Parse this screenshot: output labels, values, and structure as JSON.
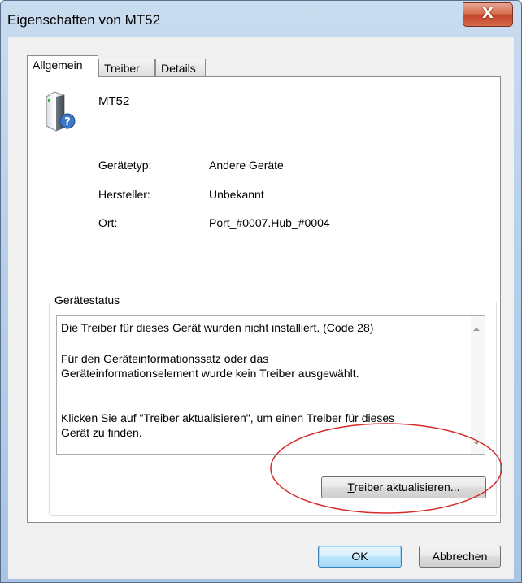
{
  "window": {
    "title": "Eigenschaften von MT52",
    "close_symbol": "X"
  },
  "tabs": [
    {
      "label": "Allgemein",
      "active": true
    },
    {
      "label": "Treiber",
      "active": false
    },
    {
      "label": "Details",
      "active": false
    }
  ],
  "device": {
    "name": "MT52",
    "icon": "unknown-device-icon"
  },
  "properties": [
    {
      "label": "Gerätetyp:",
      "value": "Andere Geräte"
    },
    {
      "label": "Hersteller:",
      "value": "Unbekannt"
    },
    {
      "label": "Ort:",
      "value": "Port_#0007.Hub_#0004"
    }
  ],
  "status": {
    "group_title": "Gerätestatus",
    "lines": [
      "Die Treiber für dieses Gerät wurden nicht installiert. (Code 28)",
      "Für den Geräteinformationssatz oder das",
      "Geräteinformationselement wurde kein Treiber ausgewählt.",
      "Klicken Sie auf \"Treiber aktualisieren\", um einen Treiber für dieses",
      "Gerät zu finden."
    ]
  },
  "buttons": {
    "update_driver_accel": "T",
    "update_driver_rest": "reiber aktualisieren...",
    "ok": "OK",
    "cancel": "Abbrechen"
  },
  "annotation": {
    "highlight_color": "#d62b2b"
  }
}
